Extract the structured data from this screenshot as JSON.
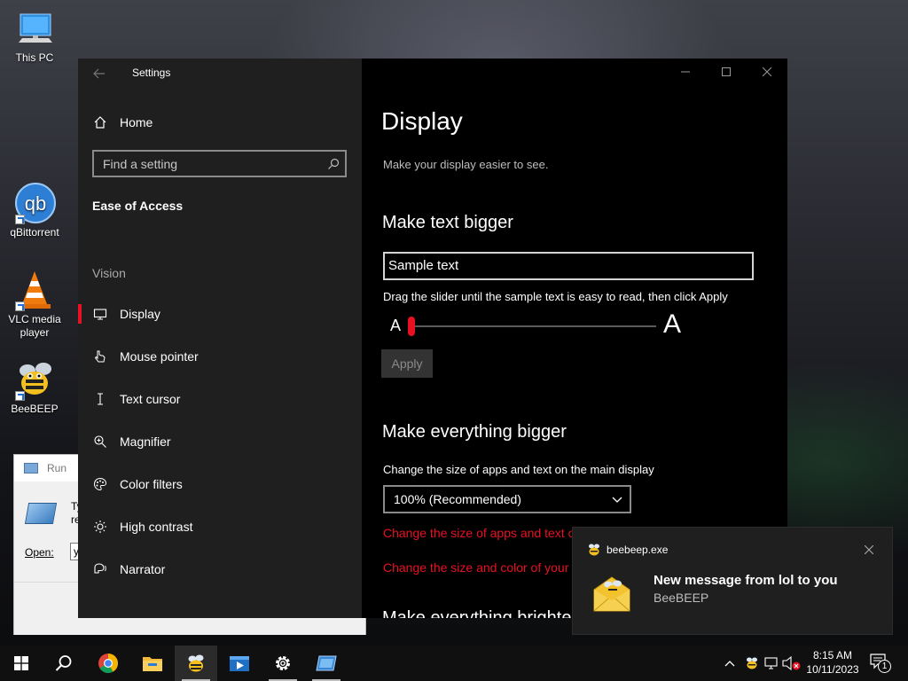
{
  "desktop": {
    "icons": [
      {
        "label": "This PC"
      },
      {
        "label": "qBittorrent"
      },
      {
        "label": "VLC media player"
      },
      {
        "label": "BeeBEEP"
      }
    ]
  },
  "run_dialog": {
    "title": "Run",
    "prompt_partial": "Ty",
    "prompt_partial2": "re",
    "open_label": "Open:",
    "input_partial": "y"
  },
  "settings": {
    "window_title": "Settings",
    "back_icon": "back-arrow-icon",
    "home_label": "Home",
    "search_placeholder": "Find a setting",
    "section_title": "Ease of Access",
    "group_label": "Vision",
    "nav_items": [
      {
        "label": "Display",
        "icon": "monitor-icon",
        "active": true
      },
      {
        "label": "Mouse pointer",
        "icon": "mouse-pointer-icon",
        "active": false
      },
      {
        "label": "Text cursor",
        "icon": "text-cursor-icon",
        "active": false
      },
      {
        "label": "Magnifier",
        "icon": "magnifier-icon",
        "active": false
      },
      {
        "label": "Color filters",
        "icon": "color-filters-icon",
        "active": false
      },
      {
        "label": "High contrast",
        "icon": "high-contrast-icon",
        "active": false
      },
      {
        "label": "Narrator",
        "icon": "narrator-icon",
        "active": false
      }
    ],
    "content": {
      "title": "Display",
      "subtitle": "Make your display easier to see.",
      "text_bigger_heading": "Make text bigger",
      "sample_text": "Sample text",
      "slider_instruction": "Drag the slider until the sample text is easy to read, then click Apply",
      "slider_small_label": "A",
      "slider_large_label": "A",
      "slider_value": 0,
      "apply_label": "Apply",
      "everything_bigger_heading": "Make everything bigger",
      "scale_description": "Change the size of apps and text on the main display",
      "scale_selected": "100% (Recommended)",
      "link_scale": "Change the size of apps and text on other displays",
      "link_pointer": "Change the size and color of your mouse pointer",
      "next_heading_partial": "Make everything brighter"
    }
  },
  "taskbar": {
    "apps": [
      "start-icon",
      "search-icon",
      "chrome-icon",
      "file-explorer-icon",
      "beebeep-icon",
      "media-player-icon",
      "settings-gear-icon",
      "run-dialog-icon"
    ],
    "clock_time": "8:15 AM",
    "clock_date": "10/11/2023",
    "notification_count": "1"
  },
  "toast": {
    "app_name": "beebeep.exe",
    "title": "New message from lol to you",
    "body": "BeeBEEP"
  },
  "colors": {
    "accent": "#e81123",
    "nav_bg": "#1f1f1f",
    "content_bg": "#000000",
    "taskbar_bg": "#101010"
  }
}
